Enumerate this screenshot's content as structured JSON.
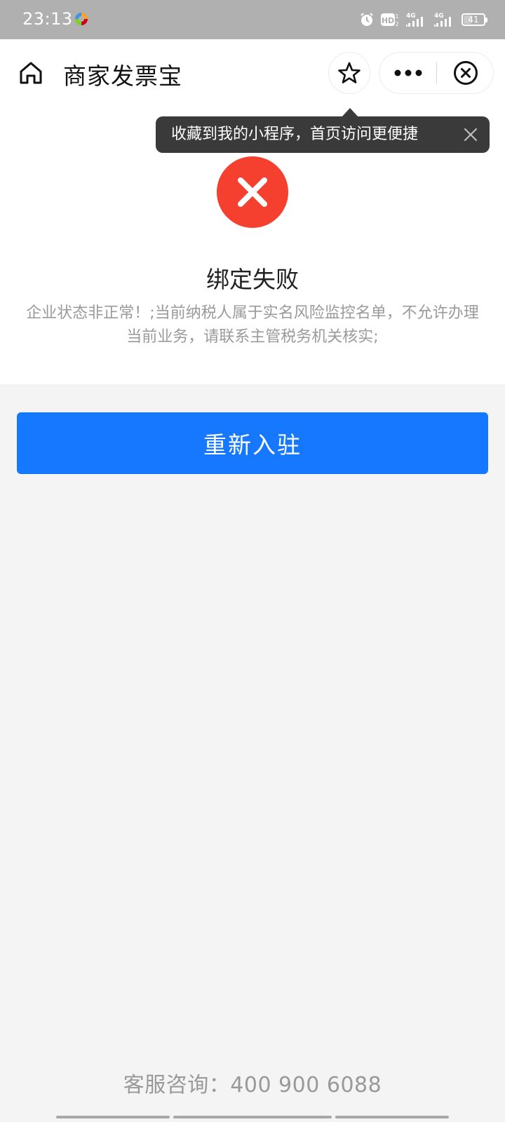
{
  "status_bar": {
    "time": "23:13",
    "battery": "41",
    "network_1": "4G",
    "network_2": "4G",
    "hd_label": "HD"
  },
  "nav": {
    "title": "商家发票宝"
  },
  "tooltip": {
    "text": "收藏到我的小程序，首页访问更便捷"
  },
  "result": {
    "title": "绑定失败",
    "description": "企业状态非正常！;当前纳税人属于实名风险监控名单，不允许办理当前业务，请联系主管税务机关核实;"
  },
  "actions": {
    "retry_label": "重新入驻"
  },
  "footer": {
    "hotline": "客服咨询：400 900 6088"
  },
  "colors": {
    "primary": "#1677ff",
    "error": "#f5402f",
    "tooltip_bg": "#3a3a3a",
    "status_bar_bg": "#b0b0b0",
    "page_bg": "#f4f4f4"
  },
  "battery_level": 0.41
}
